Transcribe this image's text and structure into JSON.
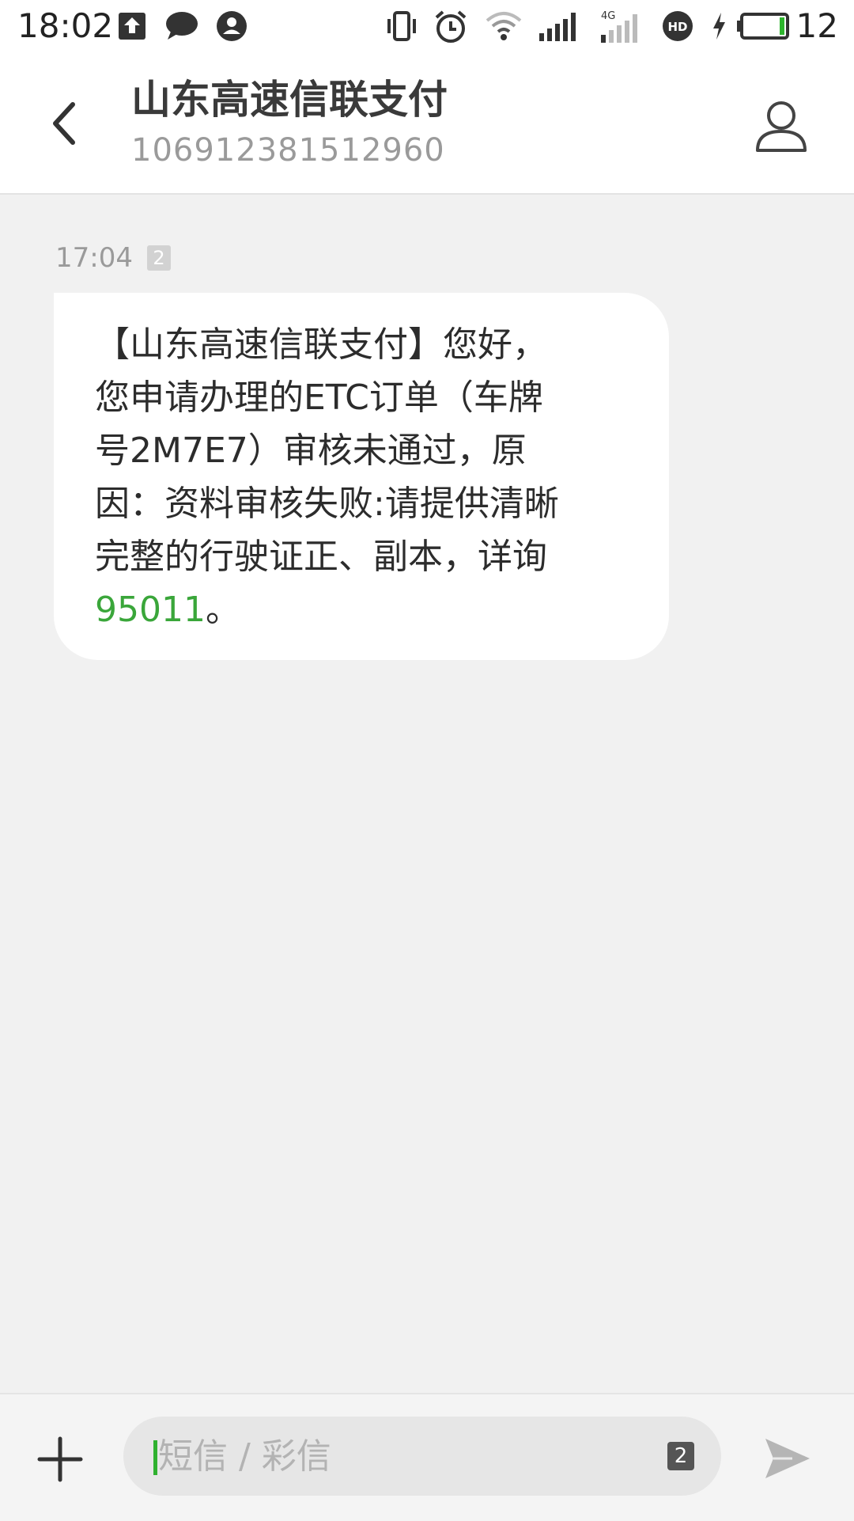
{
  "status_bar": {
    "time": "18:02",
    "battery_level": "12",
    "network_label": "4G",
    "hd_label": "HD",
    "icons": [
      "upload-icon",
      "chat-bubble-icon",
      "account-circle-icon",
      "vibrate-icon",
      "alarm-icon",
      "wifi-icon",
      "signal-icon",
      "signal-4g-icon",
      "hd-voice-icon",
      "charging-icon",
      "battery-icon"
    ]
  },
  "header": {
    "contact_name": "山东高速信联支付",
    "contact_number": "106912381512960"
  },
  "conversation": {
    "messages": [
      {
        "time": "17:04",
        "sim_badge": "2",
        "lines": [
          "【山东高速信联支付】您好，",
          "您申请办理的ETC订单（车牌",
          "号2M7E7）审核未通过，原",
          "因：资料审核失败:请提供清晰",
          "完整的行驶证正、副本，详询"
        ],
        "phone_number": "95011",
        "ending": "。"
      }
    ]
  },
  "composer": {
    "placeholder": "短信 / 彩信",
    "value": "",
    "sim_label": "2"
  },
  "colors": {
    "accent": "#3aa63a",
    "background": "#f1f1f1",
    "bubble": "#ffffff"
  }
}
